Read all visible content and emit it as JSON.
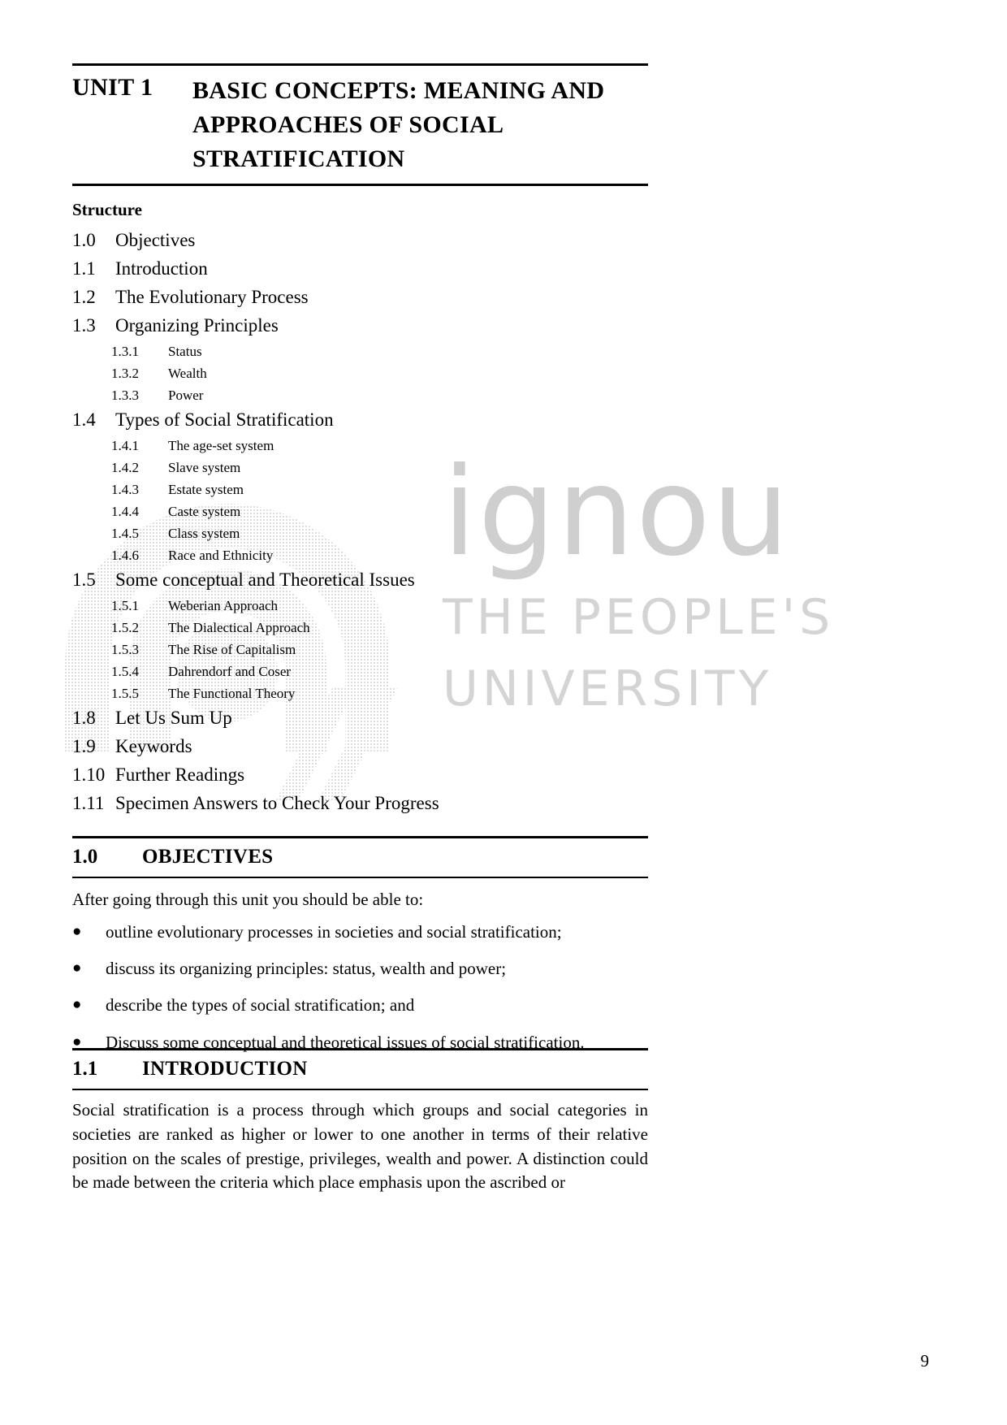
{
  "watermark": {
    "logo_text": "ignou",
    "line1": "THE PEOPLE'S",
    "line2": "UNIVERSITY"
  },
  "unit": {
    "label": "UNIT 1",
    "title": "BASIC CONCEPTS: MEANING AND APPROACHES OF SOCIAL STRATIFICATION"
  },
  "structure": {
    "heading": "Structure",
    "items": [
      {
        "num": "1.0",
        "label": "Objectives",
        "level": 1
      },
      {
        "num": "1.1",
        "label": "Introduction",
        "level": 1
      },
      {
        "num": "1.2",
        "label": "The Evolutionary Process",
        "level": 1
      },
      {
        "num": "1.3",
        "label": "Organizing Principles",
        "level": 1
      },
      {
        "num": "1.3.1",
        "label": "Status",
        "level": 2
      },
      {
        "num": "1.3.2",
        "label": "Wealth",
        "level": 2
      },
      {
        "num": "1.3.3",
        "label": "Power",
        "level": 2
      },
      {
        "num": "1.4",
        "label": "Types of Social Stratification",
        "level": 1
      },
      {
        "num": "1.4.1",
        "label": "The age-set system",
        "level": 2
      },
      {
        "num": "1.4.2",
        "label": "Slave system",
        "level": 2
      },
      {
        "num": "1.4.3",
        "label": "Estate system",
        "level": 2
      },
      {
        "num": "1.4.4",
        "label": "Caste system",
        "level": 2
      },
      {
        "num": "1.4.5",
        "label": "Class system",
        "level": 2
      },
      {
        "num": "1.4.6",
        "label": "Race and Ethnicity",
        "level": 2
      },
      {
        "num": "1.5",
        "label": "Some conceptual and Theoretical Issues",
        "level": 1
      },
      {
        "num": "1.5.1",
        "label": "Weberian Approach",
        "level": 2
      },
      {
        "num": "1.5.2",
        "label": "The Dialectical Approach",
        "level": 2
      },
      {
        "num": "1.5.3",
        "label": "The Rise of Capitalism",
        "level": 2
      },
      {
        "num": "1.5.4",
        "label": "Dahrendorf and Coser",
        "level": 2
      },
      {
        "num": "1.5.5",
        "label": "The Functional Theory",
        "level": 2
      },
      {
        "num": "1.8",
        "label": "Let Us Sum Up",
        "level": 1
      },
      {
        "num": "1.9",
        "label": "Keywords",
        "level": 1
      },
      {
        "num": "1.10",
        "label": "Further Readings",
        "level": 1
      },
      {
        "num": "1.11",
        "label": "Specimen Answers to Check Your Progress",
        "level": 1
      }
    ]
  },
  "objectives": {
    "num": "1.0",
    "title": "OBJECTIVES",
    "intro": "After going through this unit you should be able to:",
    "bullet_glyph": "●",
    "bullets": [
      "outline evolutionary processes in societies and social stratification;",
      "discuss its organizing principles: status, wealth and power;",
      "describe the types of social stratification; and",
      "Discuss some conceptual and theoretical issues of social stratification."
    ]
  },
  "introduction": {
    "num": "1.1",
    "title": "INTRODUCTION",
    "paragraph": "Social stratification is a process through which groups and social categories in societies are ranked as higher or lower to one another in terms of their relative position on the scales of prestige, privileges, wealth and power. A distinction could be made between the criteria which place emphasis upon the ascribed or"
  },
  "page_number": "9"
}
